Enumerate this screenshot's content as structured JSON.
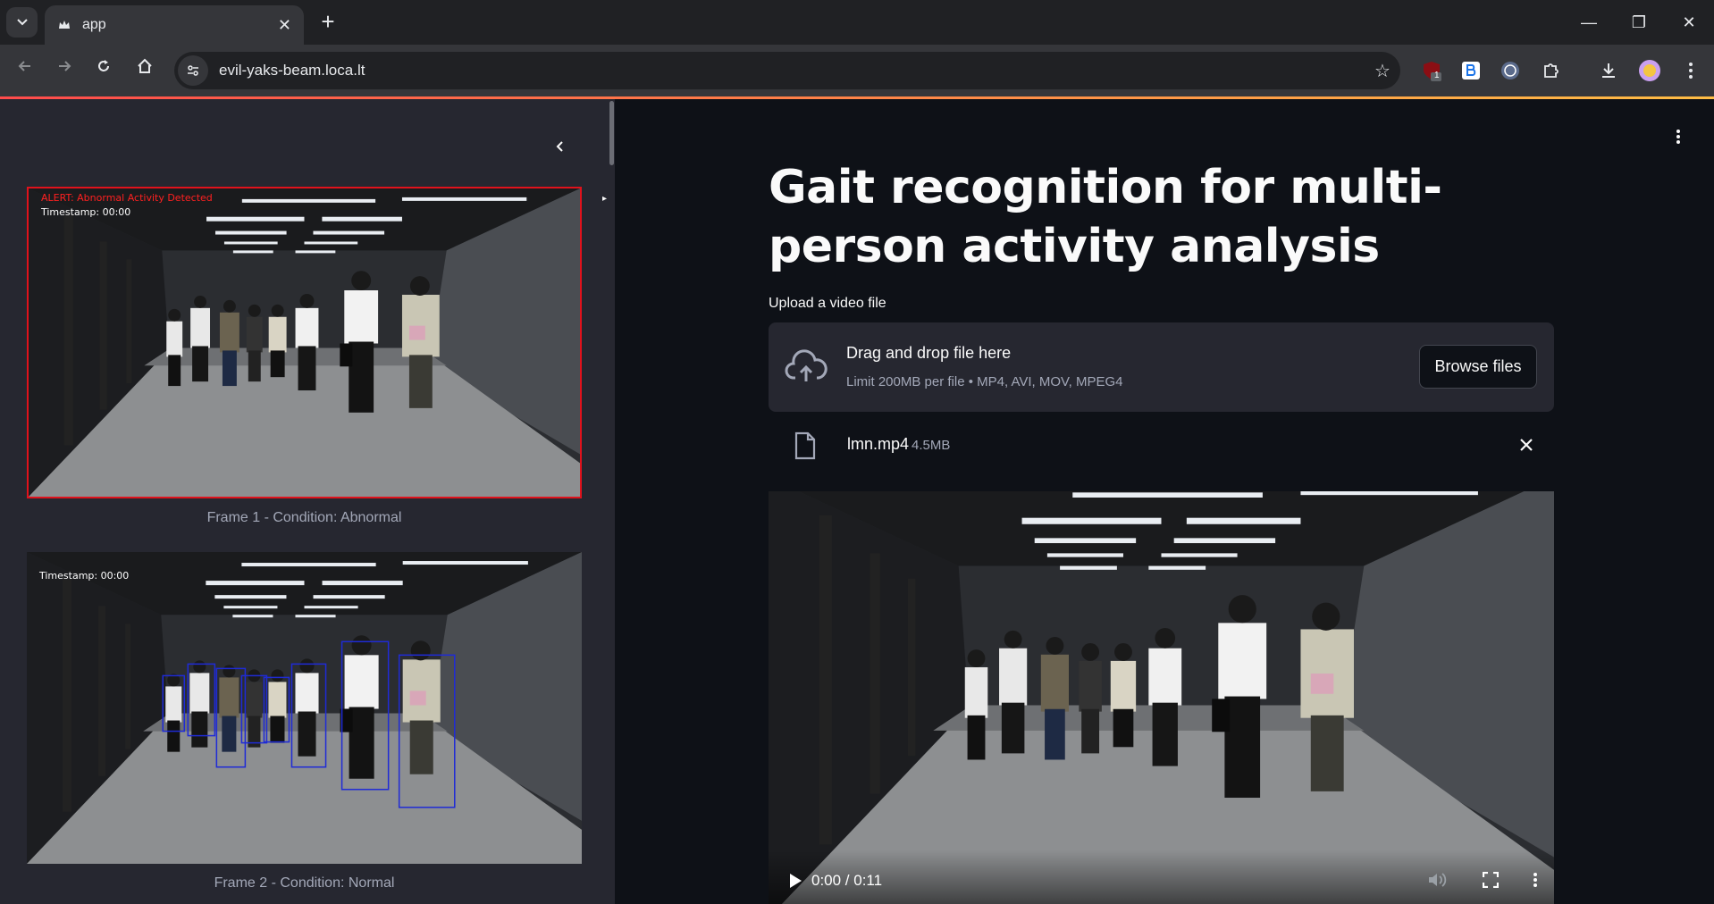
{
  "browser": {
    "tab_title": "app",
    "url": "evil-yaks-beam.loca.lt",
    "extension_badge": "1"
  },
  "sidebar": {
    "frames": [
      {
        "caption": "Frame 1 - Condition: Abnormal",
        "alert_text": "ALERT: Abnormal Activity Detected",
        "timestamp_text": "Timestamp: 00:00",
        "highlighted": true
      },
      {
        "caption": "Frame 2 - Condition: Normal",
        "timestamp_text": "Timestamp: 00:00",
        "highlighted": false
      }
    ]
  },
  "main": {
    "title": "Gait recognition for multi-person activity analysis",
    "upload": {
      "label": "Upload a video file",
      "drop_title": "Drag and drop file here",
      "drop_subtitle": "Limit 200MB per file • MP4, AVI, MOV, MPEG4",
      "browse_label": "Browse files"
    },
    "file": {
      "name": "lmn.mp4",
      "size": "4.5MB"
    },
    "video": {
      "time": "0:00 / 0:11"
    }
  },
  "colors": {
    "accent": "#ff4b4b",
    "alert_border": "#e0121c",
    "detection_box": "#1f2bd6",
    "sidebar_bg": "#262730",
    "main_bg": "#0e1117"
  }
}
